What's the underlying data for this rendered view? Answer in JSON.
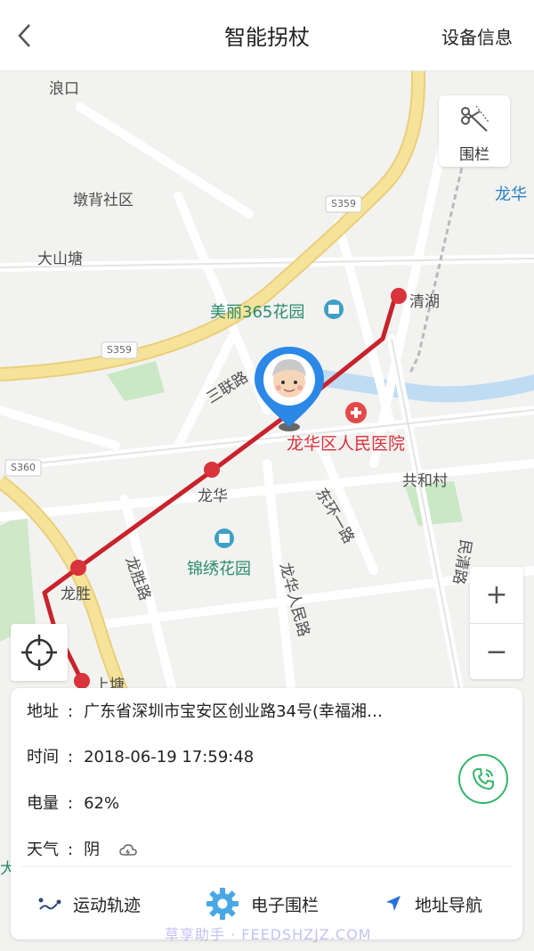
{
  "header": {
    "title": "智能拐杖",
    "right_label": "设备信息"
  },
  "map": {
    "labels": {
      "langkou": "浪口",
      "dunbei": "墩背社区",
      "dashantang": "大山塘",
      "s359_top": "S359",
      "s359_left": "S359",
      "s360": "S360",
      "longhua_top": "龙华",
      "meili": "美丽365花园",
      "qinghu": "清湖",
      "sanlian": "三联路",
      "hospital": "龙华区人民医院",
      "gonghe": "共和村",
      "longhua_station": "龙华",
      "donghuan": "东环一路",
      "jinxiu": "锦绣花园",
      "longsheng_road": "龙胜路",
      "minqing": "民清路",
      "longhua_renmin": "龙华人民路",
      "longsheng_station": "龙胜",
      "shangtang": "上塘",
      "da": "大"
    },
    "fence_label": "围栏",
    "zoom_in": "+",
    "zoom_out": "−"
  },
  "info": {
    "address_key": "地址",
    "address_value": "广东省深圳市宝安区创业路34号(幸福湘…",
    "time_key": "时间",
    "time_value": "2018-06-19  17:59:48",
    "battery_key": "电量",
    "battery_value": "62%",
    "weather_key": "天气",
    "weather_value": "阴",
    "sep": ":"
  },
  "actions": {
    "track": "运动轨迹",
    "fence": "电子围栏",
    "nav": "地址导航"
  },
  "watermark": "草享助手 · FEEDSHZJZ.COM",
  "colors": {
    "accent_blue": "#2b88e6",
    "route_red": "#c8232c",
    "call_green": "#33b56a",
    "road_yellow": "#f6df8c"
  }
}
